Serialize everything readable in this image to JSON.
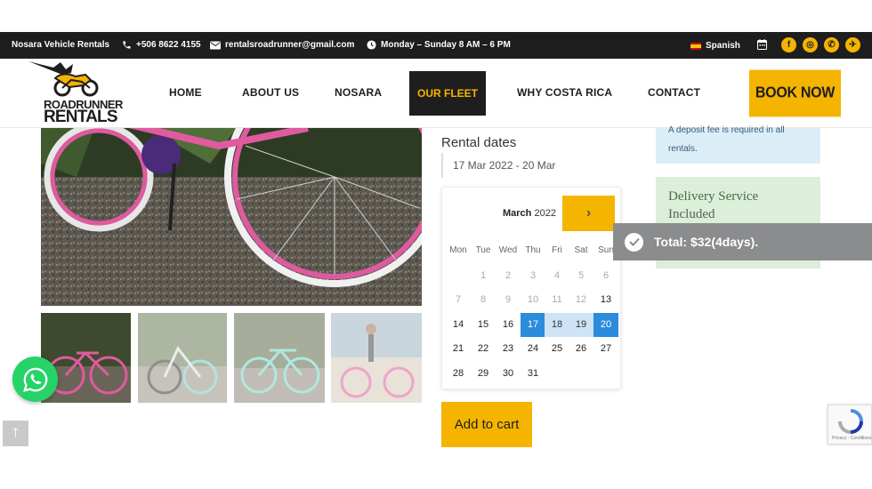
{
  "topbar": {
    "brand": "Nosara Vehicle Rentals",
    "phone": "+506 8622 4155",
    "email": "rentalsroadrunner@gmail.com",
    "hours": "Monday – Sunday 8 AM – 6 PM",
    "language": "Spanish",
    "social": [
      {
        "icon": "facebook-icon",
        "glyph": "f"
      },
      {
        "icon": "instagram-icon",
        "glyph": "◎"
      },
      {
        "icon": "whatsapp-icon",
        "glyph": "✆"
      },
      {
        "icon": "share-icon",
        "glyph": "✈"
      }
    ]
  },
  "logo": {
    "line1": "ROADRUNNER",
    "line2": "RENTALS"
  },
  "nav": {
    "items": [
      "HOME",
      "ABOUT US",
      "NOSARA",
      "OUR FLEET",
      "WHY COSTA RICA",
      "CONTACT"
    ],
    "active": "OUR FLEET",
    "book_now": "BOOK NOW"
  },
  "booking": {
    "rental_dates_label": "Rental dates",
    "date_range": "17 Mar 2022 - 20 Mar",
    "calendar": {
      "month": "March",
      "year": "2022",
      "weekdays": [
        "Mon",
        "Tue",
        "Wed",
        "Thu",
        "Fri",
        "Sat",
        "Sun"
      ],
      "rows": [
        [
          "",
          "1",
          "2",
          "3",
          "4",
          "5",
          "6"
        ],
        [
          "7",
          "8",
          "9",
          "10",
          "11",
          "12",
          "13"
        ],
        [
          "14",
          "15",
          "16",
          "17",
          "18",
          "19",
          "20"
        ],
        [
          "21",
          "22",
          "23",
          "24",
          "25",
          "26",
          "27"
        ],
        [
          "28",
          "29",
          "30",
          "31",
          "",
          "",
          ""
        ]
      ],
      "range_start": "17",
      "range_end": "20"
    },
    "add_to_cart": "Add to cart"
  },
  "notices": {
    "deposit": "A deposit fee is required in all rentals.",
    "delivery": "Delivery Service Included"
  },
  "toast": {
    "text": "Total: $32(4days)."
  },
  "recaptcha": {
    "footer": "Privacy - Conditions"
  },
  "colors": {
    "accent": "#f5b400",
    "dark": "#1e1e1e",
    "select": "#2b8cdc"
  }
}
